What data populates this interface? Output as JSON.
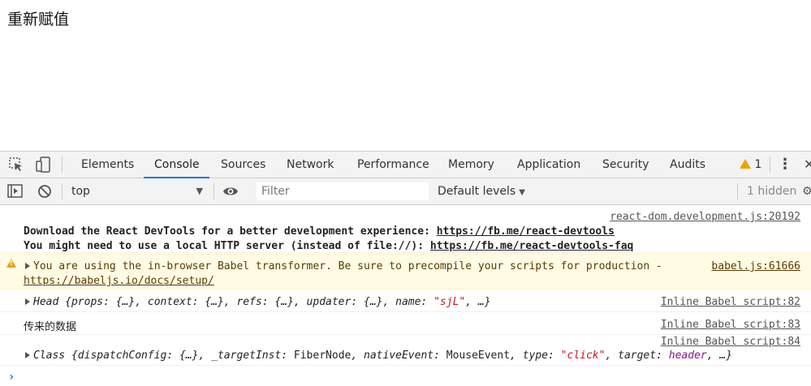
{
  "page": {
    "heading": "重新赋值"
  },
  "devtools": {
    "tabs": [
      "Elements",
      "Console",
      "Sources",
      "Network",
      "Performance",
      "Memory",
      "Application",
      "Security",
      "Audits"
    ],
    "active_tab": "Console",
    "warning_count": "1",
    "close_glyph": "✕",
    "kebab_glyph": "⋮"
  },
  "console_toolbar": {
    "context": "top",
    "filter_placeholder": "Filter",
    "levels": "Default levels",
    "hidden": "1 hidden"
  },
  "console": {
    "messages": [
      {
        "source": "react-dom.development.js:20192",
        "line1_text": "Download the React DevTools for a better development experience: ",
        "line1_link": "https://fb.me/react-devtools",
        "line2_text": "You might need to use a local HTTP server (instead of file://): ",
        "line2_link": "https://fb.me/react-devtools-faq"
      },
      {
        "level": "warning",
        "source": "babel.js:61666",
        "text": "You are using the in-browser Babel transformer. Be sure to precompile your scripts for production - ",
        "link": "https://babeljs.io/docs/setup/"
      },
      {
        "source": "Inline Babel script:82",
        "object_name": "Head",
        "object_body_a": " {props: {…}, context: {…}, refs: {…}, updater: {…}, name: ",
        "object_str": "\"sjL\"",
        "object_body_b": ", …}"
      },
      {
        "source": "Inline Babel script:83",
        "text": "传来的数据"
      },
      {
        "source": "Inline Babel script:84",
        "object_name": "Class",
        "part_a": " {dispatchConfig: {…}, _targetInst: ",
        "part_b": "FiberNode",
        "part_c": ", nativeEvent: ",
        "part_d": "MouseEvent",
        "part_e": ", type: ",
        "type_str": "\"click\"",
        "part_f": ", target: ",
        "target_val": "header",
        "part_g": ", …}"
      }
    ],
    "prompt": "›"
  }
}
